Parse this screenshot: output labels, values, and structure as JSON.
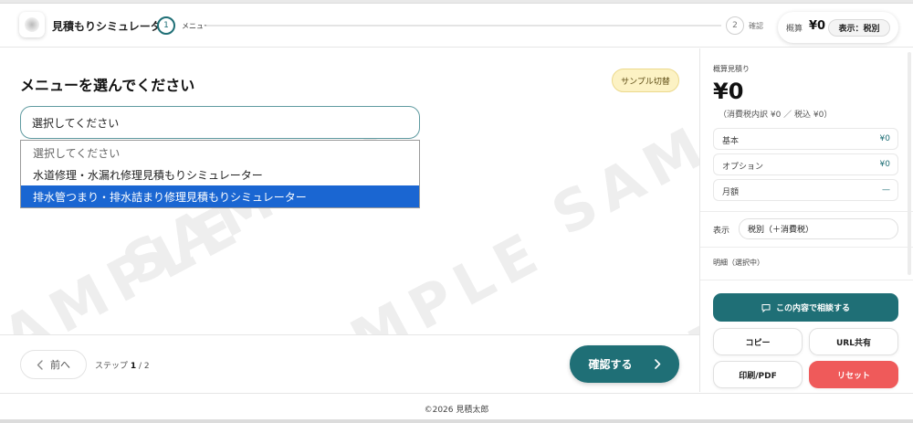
{
  "header": {
    "app_title": "見積もりシミュレーター",
    "steps": [
      {
        "number": "1",
        "label": "メニュー"
      },
      {
        "number": "2",
        "label": "確認"
      }
    ],
    "estimate_label": "概算",
    "estimate_amount": "¥0",
    "tax_toggle": "表示：税別"
  },
  "main": {
    "heading": "メニューを選んでください",
    "sample_button": "サンプル切替",
    "select_value": "選択してください",
    "options": [
      "選択してください",
      "水道修理・水漏れ修理見積もりシミュレーター",
      "排水管つまり・排水詰まり修理見積もりシミュレーター"
    ],
    "highlighted_option_index": 2,
    "watermark": "SAMPLE"
  },
  "nav": {
    "prev": "前へ",
    "step_prefix": "ステップ",
    "step_current": "1",
    "step_sep": " / ",
    "step_total": "2",
    "confirm": "確認する"
  },
  "sidebar": {
    "label": "概算見積り",
    "total": "¥0",
    "tax_note": "（消費税内訳 ¥0 ／ 税込 ¥0）",
    "rows": [
      {
        "key": "基本",
        "value": "¥0"
      },
      {
        "key": "オプション",
        "value": "¥0"
      },
      {
        "key": "月額",
        "value": "—"
      }
    ],
    "display_label": "表示",
    "display_value": "税別（＋消費税）",
    "detail_label": "明細（選択中）",
    "consult_button": "この内容で相談する",
    "copy_button": "コピー",
    "url_button": "URL共有",
    "print_button": "印刷/PDF",
    "reset_button": "リセット"
  },
  "footer": {
    "copyright": "©2026 見積太郎"
  },
  "colors": {
    "accent": "#1f6f76",
    "highlight": "#1a66d2",
    "reset": "#ef5a5a",
    "sample_bg": "#fcf2c4"
  }
}
